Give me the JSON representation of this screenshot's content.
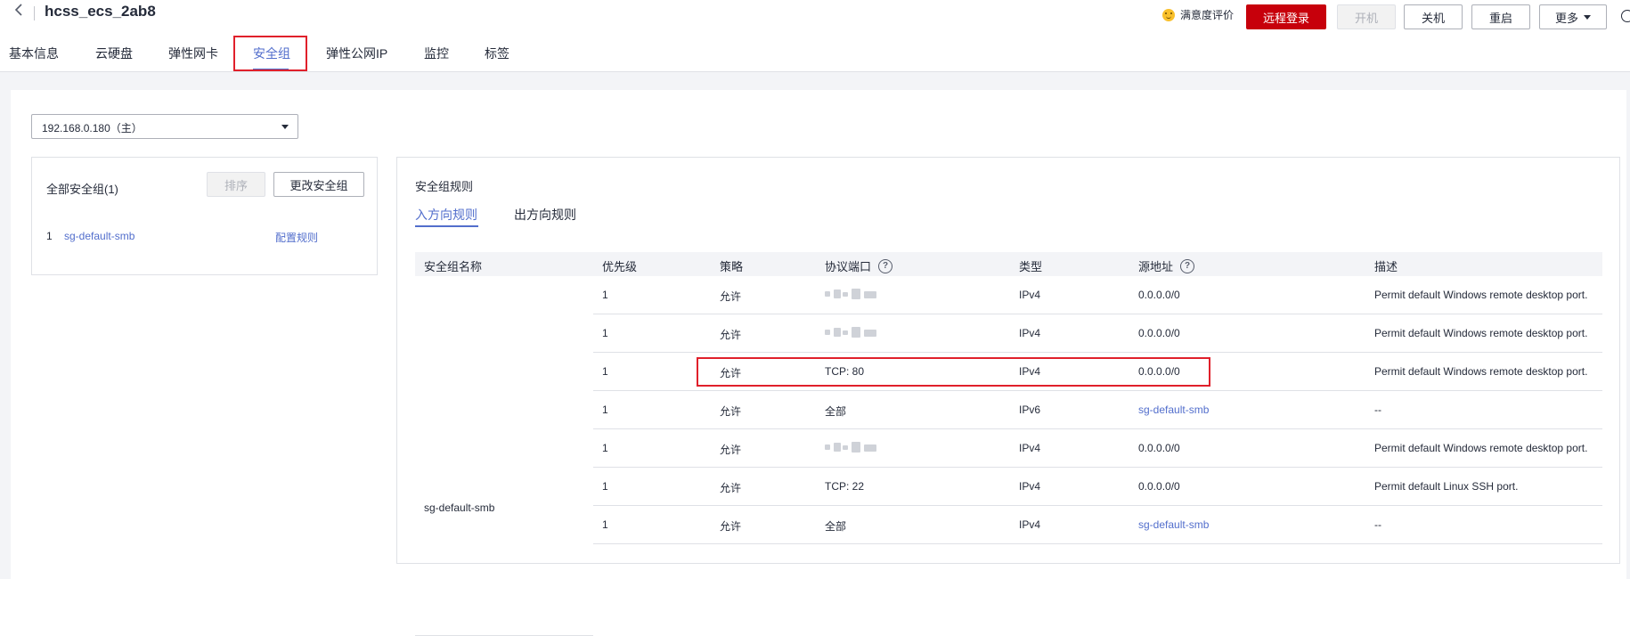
{
  "header": {
    "title": "hcss_ecs_2ab8",
    "rating_label": "满意度评价",
    "buttons": {
      "remote_login": "远程登录",
      "start": "开机",
      "shutdown": "关机",
      "restart": "重启",
      "more": "更多"
    }
  },
  "tabs": [
    {
      "label": "基本信息"
    },
    {
      "label": "云硬盘"
    },
    {
      "label": "弹性网卡"
    },
    {
      "label": "安全组"
    },
    {
      "label": "弹性公网IP"
    },
    {
      "label": "监控"
    },
    {
      "label": "标签"
    }
  ],
  "active_tab": "安全组",
  "nic_select": {
    "value": "192.168.0.180（主）"
  },
  "left_panel": {
    "title": "全部安全组(1)",
    "sort_button": "排序",
    "change_button": "更改安全组",
    "items": [
      {
        "index": "1",
        "name": "sg-default-smb",
        "action": "配置规则"
      }
    ]
  },
  "right_panel": {
    "title": "安全组规则",
    "subtabs": [
      "入方向规则",
      "出方向规则"
    ],
    "columns": [
      "安全组名称",
      "优先级",
      "策略",
      "协议端口",
      "类型",
      "源地址",
      "描述"
    ],
    "group_name": "sg-default-smb",
    "rows": [
      {
        "priority": "1",
        "policy": "允许",
        "port": "",
        "port_blurred": true,
        "type": "IPv4",
        "source": "0.0.0.0/0",
        "source_link": false,
        "desc": "Permit default Windows remote desktop port."
      },
      {
        "priority": "1",
        "policy": "允许",
        "port": "",
        "port_blurred": true,
        "type": "IPv4",
        "source": "0.0.0.0/0",
        "source_link": false,
        "desc": "Permit default Windows remote desktop port."
      },
      {
        "priority": "1",
        "policy": "允许",
        "port": "TCP: 80",
        "port_blurred": false,
        "type": "IPv4",
        "source": "0.0.0.0/0",
        "source_link": false,
        "desc": "Permit default Windows remote desktop port."
      },
      {
        "priority": "1",
        "policy": "允许",
        "port": "全部",
        "port_blurred": false,
        "type": "IPv6",
        "source": "sg-default-smb",
        "source_link": true,
        "desc": "--"
      },
      {
        "priority": "1",
        "policy": "允许",
        "port": "",
        "port_blurred": true,
        "type": "IPv4",
        "source": "0.0.0.0/0",
        "source_link": false,
        "desc": "Permit default Windows remote desktop port."
      },
      {
        "priority": "1",
        "policy": "允许",
        "port": "TCP: 22",
        "port_blurred": false,
        "type": "IPv4",
        "source": "0.0.0.0/0",
        "source_link": false,
        "desc": "Permit default Linux SSH port."
      },
      {
        "priority": "1",
        "policy": "允许",
        "port": "全部",
        "port_blurred": false,
        "type": "IPv4",
        "source": "sg-default-smb",
        "source_link": true,
        "desc": "--"
      }
    ]
  },
  "colors": {
    "accent": "#526ecc",
    "primary_button": "#c7000b",
    "highlight_box": "#e0202b"
  }
}
